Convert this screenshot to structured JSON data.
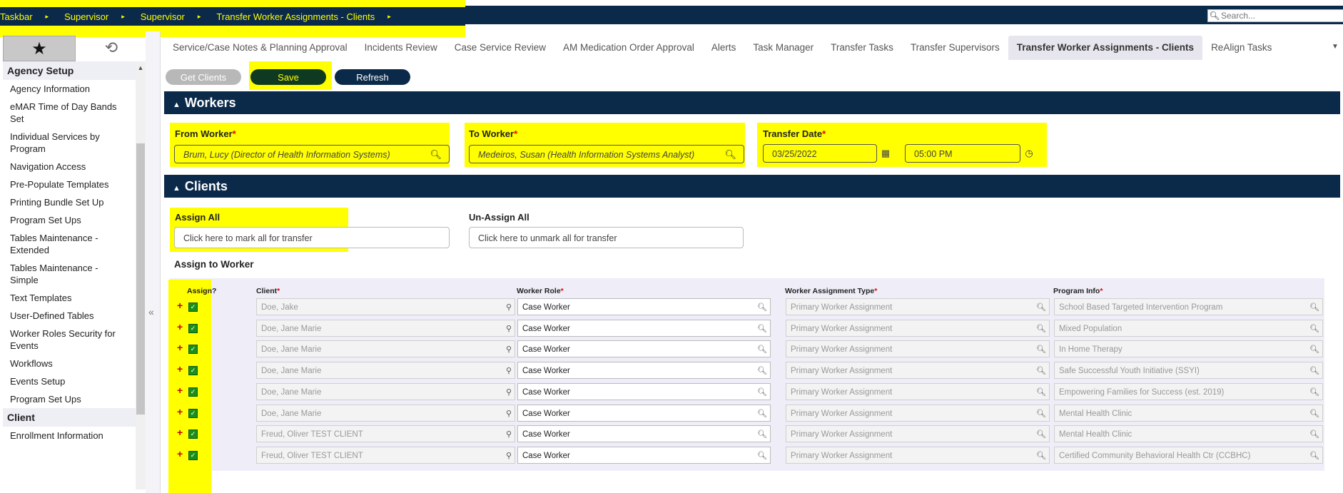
{
  "breadcrumb": [
    "Taskbar",
    "Supervisor",
    "Supervisor",
    "Transfer Worker Assignments - Clients"
  ],
  "breadcrumb_sep": "▸",
  "search": {
    "placeholder": "Search..."
  },
  "sidebar": {
    "sections": [
      {
        "title": "Agency Setup",
        "items": [
          "Agency Information",
          "eMAR Time of Day Bands Set",
          "Individual Services by Program",
          "Navigation Access",
          "Pre-Populate Templates",
          "Printing Bundle Set Up",
          "Program Set Ups",
          "Tables Maintenance - Extended",
          "Tables Maintenance - Simple",
          "Text Templates",
          "User-Defined Tables",
          "Worker Roles Security for Events",
          "Workflows",
          "Events Setup",
          "Program Set Ups"
        ]
      },
      {
        "title": "Client",
        "items": [
          "Enrollment Information"
        ]
      }
    ]
  },
  "tabs": [
    "Service/Case Notes & Planning Approval",
    "Incidents Review",
    "Case Service Review",
    "AM Medication Order Approval",
    "Alerts",
    "Task Manager",
    "Transfer Tasks",
    "Transfer Supervisors",
    "Transfer Worker Assignments - Clients",
    "ReAlign Tasks"
  ],
  "active_tab": "Transfer Worker Assignments - Clients",
  "buttons": {
    "get_clients": "Get Clients",
    "save": "Save",
    "refresh": "Refresh"
  },
  "workers": {
    "title": "Workers",
    "from_label": "From Worker",
    "from_value": "Brum, Lucy (Director of Health Information Systems)",
    "to_label": "To Worker",
    "to_value": "Medeiros, Susan (Health Information Systems Analyst)",
    "date_label": "Transfer Date",
    "date_value": "03/25/2022",
    "time_value": "05:00 PM"
  },
  "clients": {
    "title": "Clients",
    "assign_all_label": "Assign All",
    "assign_all_value": "Click here to mark all for transfer",
    "unassign_all_label": "Un-Assign All",
    "unassign_all_value": "Click here to unmark all for transfer",
    "assign_to_worker": "Assign to Worker"
  },
  "table": {
    "headers": {
      "assign": "Assign?",
      "client": "Client",
      "role": "Worker Role",
      "type": "Worker Assignment Type",
      "program": "Program Info"
    },
    "rows": [
      {
        "client": "Doe, Jake",
        "role": "Case Worker",
        "type": "Primary Worker Assignment",
        "program": "School Based Targeted Intervention Program"
      },
      {
        "client": "Doe, Jane Marie",
        "role": "Case Worker",
        "type": "Primary Worker Assignment",
        "program": "Mixed Population"
      },
      {
        "client": "Doe, Jane Marie",
        "role": "Case Worker",
        "type": "Primary Worker Assignment",
        "program": "In Home Therapy"
      },
      {
        "client": "Doe, Jane Marie",
        "role": "Case Worker",
        "type": "Primary Worker Assignment",
        "program": "Safe Successful Youth Initiative (SSYI)"
      },
      {
        "client": "Doe, Jane Marie",
        "role": "Case Worker",
        "type": "Primary Worker Assignment",
        "program": "Empowering Families for Success (est. 2019)"
      },
      {
        "client": "Doe, Jane Marie",
        "role": "Case Worker",
        "type": "Primary Worker Assignment",
        "program": "Mental Health Clinic"
      },
      {
        "client": "Freud, Oliver TEST CLIENT",
        "role": "Case Worker",
        "type": "Primary Worker Assignment",
        "program": "Mental Health Clinic"
      },
      {
        "client": "Freud, Oliver TEST CLIENT",
        "role": "Case Worker",
        "type": "Primary Worker Assignment",
        "program": "Certified Community Behavioral Health Ctr (CCBHC)"
      }
    ]
  },
  "colors": {
    "navy": "#0b2a4a",
    "highlight": "#ffff00",
    "save_bg": "#0f3a22"
  }
}
